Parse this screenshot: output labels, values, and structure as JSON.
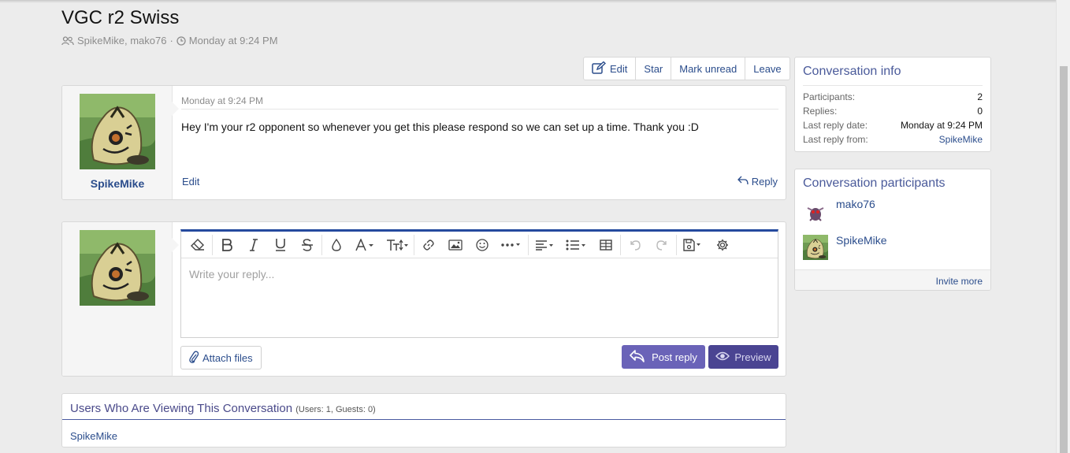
{
  "page": {
    "title": "VGC r2 Swiss",
    "participants_text": "SpikeMike, mako76",
    "separator": "·",
    "date": "Monday at 9:24 PM"
  },
  "actions": {
    "edit": "Edit",
    "star": "Star",
    "mark_unread": "Mark unread",
    "leave": "Leave"
  },
  "message": {
    "author": "SpikeMike",
    "date": "Monday at 9:24 PM",
    "body": "Hey I'm your r2 opponent so whenever you get this please respond so we can set up a time. Thank you :D",
    "edit_label": "Edit",
    "reply_label": "Reply"
  },
  "reply": {
    "placeholder": "Write your reply...",
    "attach_label": "Attach files",
    "post_label": "Post reply",
    "preview_label": "Preview"
  },
  "viewers": {
    "title": "Users Who Are Viewing This Conversation",
    "counts": "(Users: 1, Guests: 0)",
    "users": "SpikeMike"
  },
  "conversation_info": {
    "title": "Conversation info",
    "rows": [
      {
        "label": "Participants:",
        "value": "2"
      },
      {
        "label": "Replies:",
        "value": "0"
      },
      {
        "label": "Last reply date:",
        "value": "Monday at 9:24 PM"
      },
      {
        "label": "Last reply from:",
        "value": "SpikeMike"
      }
    ]
  },
  "participants_box": {
    "title": "Conversation participants",
    "users": [
      "mako76",
      "SpikeMike"
    ],
    "invite_label": "Invite more"
  },
  "colors": {
    "link": "#2b4d8c",
    "post_button": "#6a63b8",
    "preview_button": "#4a4492",
    "editor_accent": "#254a9e"
  }
}
